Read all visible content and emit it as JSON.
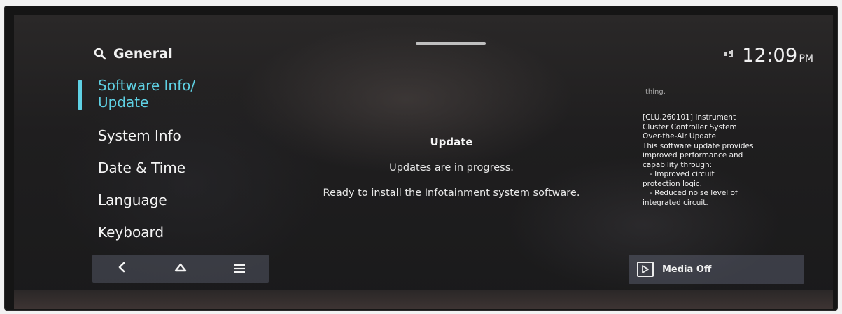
{
  "header": {
    "title": "General",
    "status_icon": "signal-icon",
    "time": "12:09",
    "ampm": "PM"
  },
  "menu": {
    "items": [
      {
        "label": "Software Info/\nUpdate",
        "active": true
      },
      {
        "label": "System Info",
        "active": false
      },
      {
        "label": "Date & Time",
        "active": false
      },
      {
        "label": "Language",
        "active": false
      },
      {
        "label": "Keyboard",
        "active": false
      }
    ]
  },
  "nav": {
    "back_icon": "chevron-left-icon",
    "home_icon": "home-icon",
    "menu_icon": "hamburger-menu-icon"
  },
  "main": {
    "title": "Update",
    "status": "Updates are in progress.",
    "message": "Ready to install the Infotainment system software."
  },
  "notes": {
    "fragment": "thing.",
    "lines": [
      "[CLU.260101] Instrument",
      "Cluster Controller System",
      "Over-the-Air Update",
      "This software update provides",
      "improved performance and",
      "capability through:",
      "   - Improved circuit",
      "protection logic.",
      "   - Reduced noise level of",
      "integrated circuit."
    ]
  },
  "media": {
    "label": "Media Off",
    "icon": "play-icon"
  },
  "colors": {
    "accent": "#5fd1e4",
    "background": "#1f1e1f",
    "panel": "#5a5e6e"
  }
}
